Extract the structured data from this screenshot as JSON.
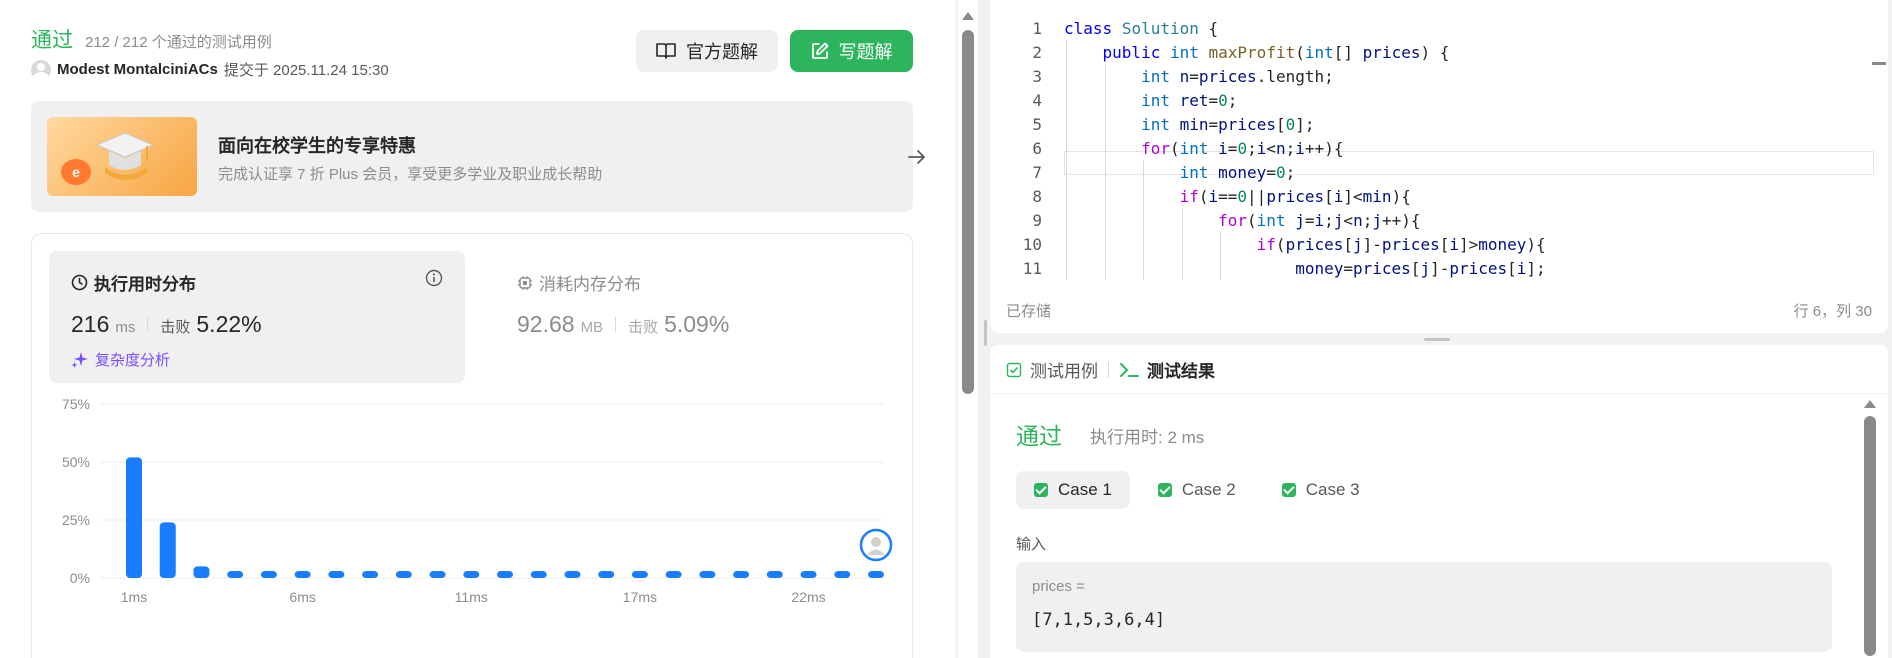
{
  "submission": {
    "status": "通过",
    "passed_summary": "212 / 212 个通过的测试用例",
    "author": "Modest MontalciniACs",
    "submitted_at": "提交于 2025.11.24 15:30",
    "editorial_label": "官方题解",
    "write_solution_label": "写题解"
  },
  "promo": {
    "title": "面向在校学生的专享特惠",
    "subtitle": "完成认证享 7 折 Plus 会员，享受更多学业及职业成长帮助",
    "badge": "e"
  },
  "runtime": {
    "title": "执行用时分布",
    "value": "216",
    "unit": "ms",
    "beat_label": "击败",
    "beat_pct": "5.22%",
    "complexity_label": "复杂度分析"
  },
  "memory": {
    "title": "消耗内存分布",
    "value": "92.68",
    "unit": "MB",
    "beat_label": "击败",
    "beat_pct": "5.09%"
  },
  "chart_data": {
    "type": "bar",
    "title": "",
    "xlabel": "",
    "ylabel": "",
    "ylim": [
      0,
      75
    ],
    "y_ticks": [
      "75%",
      "50%",
      "25%",
      "0%"
    ],
    "y_tick_values": [
      75,
      50,
      25,
      0
    ],
    "x_tick_labels": [
      "1ms",
      "6ms",
      "11ms",
      "17ms",
      "22ms"
    ],
    "x_tick_indices": [
      0,
      5,
      10,
      15,
      20
    ],
    "values": [
      52,
      24,
      5,
      1,
      1,
      1,
      1,
      1,
      1,
      1,
      1,
      1,
      1,
      1,
      1,
      1,
      1,
      1,
      1,
      1,
      1,
      1,
      1
    ],
    "user_marker_index": 22,
    "grid": true,
    "color": "#1a7cff"
  },
  "editor": {
    "lines": [
      "class Solution {",
      "    public int maxProfit(int[] prices) {",
      "        int n=prices.length;",
      "        int ret=0;",
      "        int min=prices[0];",
      "        for(int i=0;i<n;i++){",
      "            int money=0;",
      "            if(i==0||prices[i]<min){",
      "                for(int j=i;j<n;j++){",
      "                    if(prices[j]-prices[i]>money){",
      "                        money=prices[j]-prices[i];"
    ],
    "saved_label": "已存储",
    "cursor_pos": "行 6，列 30"
  },
  "results": {
    "tab_cases": "测试用例",
    "tab_results": "测试结果",
    "status": "通过",
    "runtime": "执行用时: 2 ms",
    "cases": [
      "Case 1",
      "Case 2",
      "Case 3"
    ],
    "input_label": "输入",
    "input_var": "prices =",
    "input_value": "[7,1,5,3,6,4]"
  },
  "colors": {
    "accent_green": "#2db55d",
    "bar_blue": "#1a7cff",
    "complexity_purple": "#7c4dff"
  }
}
